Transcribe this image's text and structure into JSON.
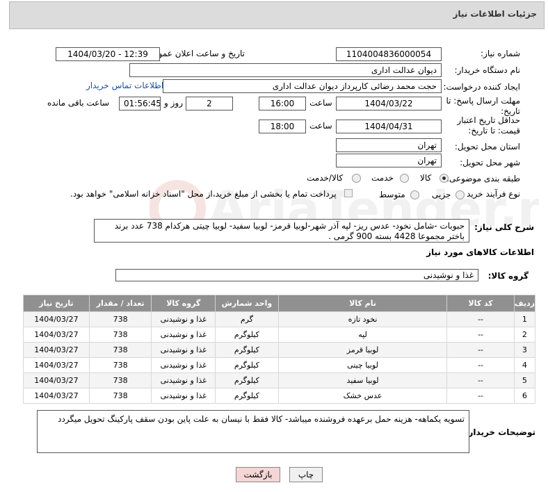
{
  "header": {
    "title": "جزئیات اطلاعات نیاز"
  },
  "labels": {
    "need_number": "شماره نیاز:",
    "announce_datetime": "تاریخ و ساعت اعلان عمومی:",
    "buyer_org": "نام دستگاه خریدار:",
    "requester": "ایجاد کننده درخواست:",
    "contact_link": "اطلاعات تماس خریدار",
    "reply_deadline": "مهلت ارسال پاسخ: تا تاریخ:",
    "time": "ساعت",
    "day_and": "روز و",
    "remaining": "ساعت باقی مانده",
    "price_validity": "حداقل تاریخ اعتبار قیمت: تا تاریخ:",
    "delivery_province": "استان محل تحویل:",
    "delivery_city": "شهر محل تحویل:",
    "category": "طبقه بندی موضوعی:",
    "purchase_type": "نوع فرآیند خرید :",
    "general_desc": "شرح کلی نیاز:",
    "goods_info": "اطلاعات کالاهای مورد نیاز",
    "goods_group": "گروه کالا:",
    "buyer_notes": "توضیحات خریدار:"
  },
  "values": {
    "need_number": "1104004836000054",
    "announce_datetime": "1404/03/20 - 12:39",
    "buyer_org": "دیوان عدالت اداری",
    "requester": "حجت محمد رضائی کارپرداز دیوان عدالت اداری",
    "reply_date": "1404/03/22",
    "reply_time": "16:00",
    "days": "2",
    "remaining_time": "01:56:45",
    "validity_date": "1404/04/31",
    "validity_time": "18:00",
    "province": "تهران",
    "city": "تهران",
    "general_desc": "حبوبات -شامل نخود- عدس ریز- لپه آذر شهر-لوبیا قرمز- لوبیا سفید- لوبیا چیتی هرکدام 738 عدد برند باختر مجموعا 4428 بسته 900 گرمی .",
    "goods_group": "غذا و نوشیدنی",
    "buyer_notes": "تسویه یکماهه- هزینه حمل برعهده فروشنده میباشد- کالا فقط با نیسان به علت پاین بودن سقف پارکینگ تحویل میگردد"
  },
  "category_options": [
    {
      "label": "کالا",
      "selected": true
    },
    {
      "label": "خدمت",
      "selected": false
    },
    {
      "label": "کالا/خدمت",
      "selected": false
    }
  ],
  "purchase_options": [
    {
      "label": "جزیی",
      "selected": true
    },
    {
      "label": "متوسط",
      "selected": false
    }
  ],
  "payment_note": "پرداخت تمام یا بخشی از مبلغ خرید،از محل \"اسناد خزانه اسلامی\" خواهد بود.",
  "table": {
    "headers": [
      "ردیف",
      "کد کالا",
      "نام کالا",
      "واحد شمارش",
      "گروه کالا",
      "تعداد / مقدار",
      "تاریخ نیاز"
    ],
    "rows": [
      [
        "1",
        "--",
        "نخود تازه",
        "گرم",
        "غذا و نوشیدنی",
        "738",
        "1404/03/27"
      ],
      [
        "2",
        "--",
        "لپه",
        "کیلوگرم",
        "غذا و نوشیدنی",
        "738",
        "1404/03/27"
      ],
      [
        "3",
        "--",
        "لوبیا قرمز",
        "کیلوگرم",
        "غذا و نوشیدنی",
        "738",
        "1404/03/27"
      ],
      [
        "4",
        "--",
        "لوبیا چیتی",
        "کیلوگرم",
        "غذا و نوشیدنی",
        "738",
        "1404/03/27"
      ],
      [
        "5",
        "--",
        "لوبیا سفید",
        "کیلوگرم",
        "غذا و نوشیدنی",
        "738",
        "1404/03/27"
      ],
      [
        "6",
        "--",
        "عدس خشک",
        "کیلوگرم",
        "غذا و نوشیدنی",
        "738",
        "1404/03/27"
      ]
    ]
  },
  "buttons": {
    "print": "چاپ",
    "back": "بازگشت"
  },
  "watermark": "AriaTender.net",
  "colors": {
    "header_bg": "#dcdcdc",
    "table_header": "#909090",
    "link": "#1a4fa0",
    "back_button": "#f5d5d5",
    "watermark": "#c0392b"
  }
}
